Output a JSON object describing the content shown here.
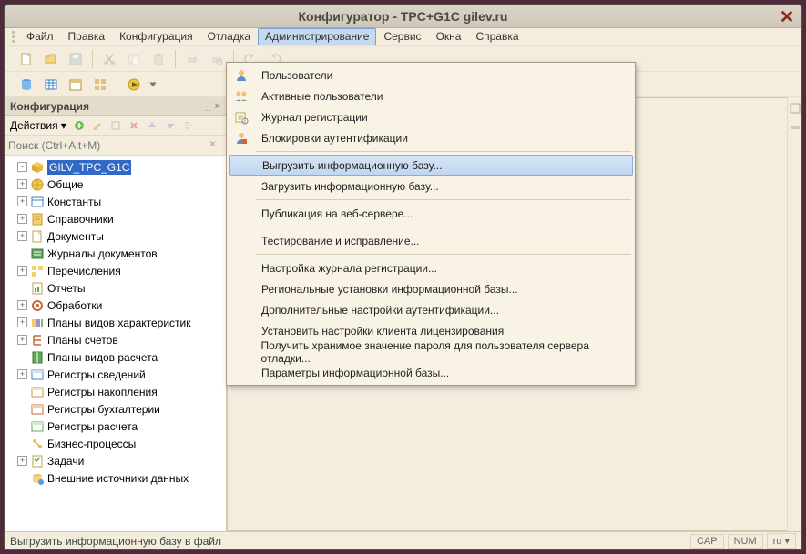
{
  "title": "Конфигуратор - TPC+G1C gilev.ru",
  "menubar": [
    "Файл",
    "Правка",
    "Конфигурация",
    "Отладка",
    "Администрирование",
    "Сервис",
    "Окна",
    "Справка"
  ],
  "active_menu_index": 4,
  "sidebar": {
    "header": "Конфигурация",
    "actions_label": "Действия",
    "search_placeholder": "Поиск (Ctrl+Alt+M)"
  },
  "tree": [
    {
      "label": "GILV_TPC_G1C",
      "icon": "cube",
      "exp": "-",
      "sel": true
    },
    {
      "label": "Общие",
      "icon": "globe",
      "exp": "+"
    },
    {
      "label": "Константы",
      "icon": "const",
      "exp": "+"
    },
    {
      "label": "Справочники",
      "icon": "book",
      "exp": "+"
    },
    {
      "label": "Документы",
      "icon": "doc",
      "exp": "+"
    },
    {
      "label": "Журналы документов",
      "icon": "journal",
      "exp": ""
    },
    {
      "label": "Перечисления",
      "icon": "enum",
      "exp": "+"
    },
    {
      "label": "Отчеты",
      "icon": "report",
      "exp": ""
    },
    {
      "label": "Обработки",
      "icon": "proc",
      "exp": "+"
    },
    {
      "label": "Планы видов характеристик",
      "icon": "plan",
      "exp": "+"
    },
    {
      "label": "Планы счетов",
      "icon": "accounts",
      "exp": "+"
    },
    {
      "label": "Планы видов расчета",
      "icon": "calc",
      "exp": ""
    },
    {
      "label": "Регистры сведений",
      "icon": "reg1",
      "exp": "+"
    },
    {
      "label": "Регистры накопления",
      "icon": "reg2",
      "exp": ""
    },
    {
      "label": "Регистры бухгалтерии",
      "icon": "reg3",
      "exp": ""
    },
    {
      "label": "Регистры расчета",
      "icon": "reg4",
      "exp": ""
    },
    {
      "label": "Бизнес-процессы",
      "icon": "bp",
      "exp": ""
    },
    {
      "label": "Задачи",
      "icon": "task",
      "exp": "+"
    },
    {
      "label": "Внешние источники данных",
      "icon": "extdata",
      "exp": ""
    }
  ],
  "dropdown": [
    {
      "label": "Пользователи",
      "icon": "user"
    },
    {
      "label": "Активные пользователи",
      "icon": "users"
    },
    {
      "label": "Журнал регистрации",
      "icon": "log"
    },
    {
      "label": "Блокировки аутентификации",
      "icon": "lock"
    },
    {
      "sep": true
    },
    {
      "label": "Выгрузить информационную базу...",
      "highlight": true
    },
    {
      "label": "Загрузить информационную базу..."
    },
    {
      "sep": true
    },
    {
      "label": "Публикация на веб-сервере..."
    },
    {
      "sep": true
    },
    {
      "label": "Тестирование и исправление..."
    },
    {
      "sep": true
    },
    {
      "label": "Настройка журнала регистрации..."
    },
    {
      "label": "Региональные установки информационной базы..."
    },
    {
      "label": "Дополнительные настройки аутентификации..."
    },
    {
      "label": "Установить настройки клиента лицензирования"
    },
    {
      "label": "Получить хранимое значение пароля для пользователя сервера отладки..."
    },
    {
      "label": "Параметры информационной базы..."
    }
  ],
  "status": {
    "left": "Выгрузить информационную базу в файл",
    "cap": "CAP",
    "num": "NUM",
    "lang": "ru"
  }
}
